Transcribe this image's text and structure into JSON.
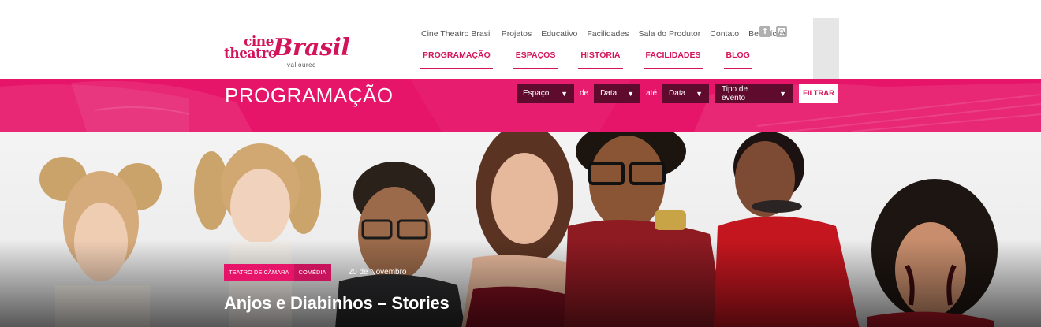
{
  "logo": {
    "line1": "cine",
    "line2": "theatro",
    "brand": "Brasil",
    "sub": "vallourec"
  },
  "topnav": [
    "Cine Theatro Brasil",
    "Projetos",
    "Educativo",
    "Facilidades",
    "Sala do Produtor",
    "Contato",
    "Benefícios"
  ],
  "social": {
    "facebook": "facebook-icon",
    "instagram": "instagram-icon"
  },
  "mainnav": [
    "PROGRAMAÇÃO",
    "ESPAÇOS",
    "HISTÓRIA",
    "FACILIDADES",
    "BLOG"
  ],
  "band": {
    "title": "PROGRAMAÇÃO",
    "filters": {
      "espaco": "Espaço",
      "de": "de",
      "data1": "Data",
      "ate": "até",
      "data2": "Data",
      "tipo": "Tipo de evento",
      "button": "FILTRAR"
    }
  },
  "event": {
    "tag_space": "TEATRO DE CÂMARA",
    "tag_genre": "COMÉDIA",
    "date": "20 de Novembro",
    "title": "Anjos e Diabinhos – Stories"
  },
  "colors": {
    "brand": "#d4145a",
    "band": "#e6156a",
    "dark": "#5e0b2e"
  }
}
